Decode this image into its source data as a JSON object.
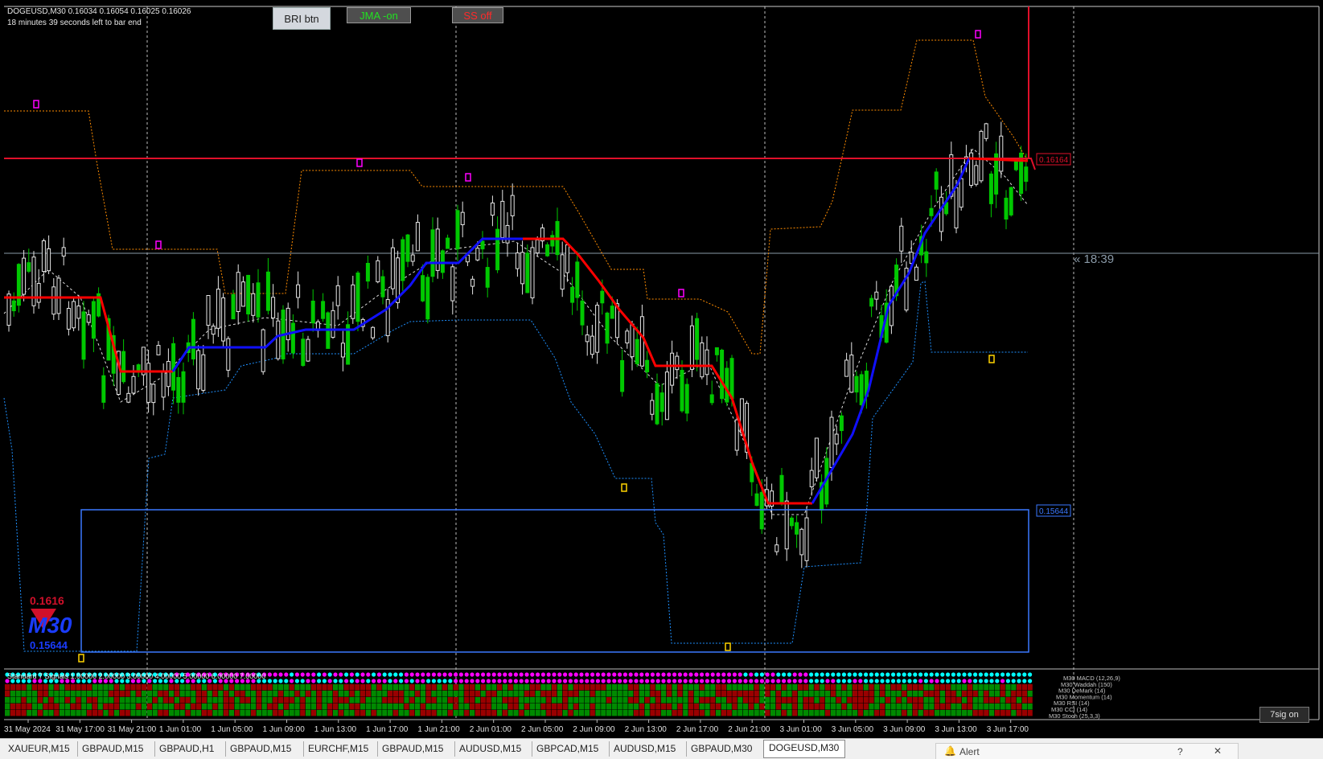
{
  "window": {
    "symbol_line": "DOGEUSD,M30  0.16034 0.16054 0.16025 0.16026",
    "countdown_line": "18 minutes 39 seconds left to bar end"
  },
  "toolbar": {
    "bri_label": "BRI btn",
    "jma_label": "JMA -on",
    "ss_label": "SS off"
  },
  "price_labels": {
    "resistance": "0.16164",
    "support": "0.15644",
    "timer": "« 18:39"
  },
  "badge": {
    "top": "0.1616",
    "timeframe": "M30",
    "bottom": "0.15644"
  },
  "x_axis": {
    "labels": [
      "31 May 2024",
      "31 May 17:00",
      "31 May 21:00",
      "1 Jun 01:00",
      "1 Jun 05:00",
      "1 Jun 09:00",
      "1 Jun 13:00",
      "1 Jun 17:00",
      "1 Jun 21:00",
      "2 Jun 01:00",
      "2 Jun 05:00",
      "2 Jun 09:00",
      "2 Jun 13:00",
      "2 Jun 17:00",
      "2 Jun 21:00",
      "3 Jun 01:00",
      "3 Jun 05:00",
      "3 Jun 09:00",
      "3 Jun 13:00",
      "3 Jun 17:00"
    ]
  },
  "indicator_panel": {
    "header": "Standard 7 Signals 1.00000 2.00000 3.00000 4.00000 5.00000 6.00000 7.00000",
    "row_labels": [
      "M30 MACD (12,26,9)",
      "M30 Waddah (150)",
      "M30 DeMark (14)",
      "M30 Momentum (14)",
      "M30 RSI (14)",
      "M30 CCI (14)",
      "M30 Stoch (25,3,3)"
    ],
    "button": "7sig on"
  },
  "tabs": [
    "XAUEUR,M15",
    "GBPAUD,M15",
    "GBPAUD,H1",
    "GBPAUD,M15",
    "EURCHF,M15",
    "GBPAUD,M15",
    "AUDUSD,M15",
    "GBPCAD,M15",
    "AUDUSD,M15",
    "GBPAUD,M30",
    "DOGEUSD,M30"
  ],
  "active_tab_index": 10,
  "alert_window": {
    "title": "Alert",
    "help": "?",
    "close": "✕"
  },
  "colors": {
    "background": "#000000",
    "bull_candle": "#00c800",
    "bear_candle": "#e6e6e6",
    "line_up": "#1010ff",
    "line_down": "#ff0000",
    "resistance": "#e0102a",
    "support_box": "#3a78ff",
    "upper_channel": "#ff8c00",
    "lower_channel": "#1e90ff",
    "signal_magenta": "#ff00ff",
    "signal_cyan": "#00ffff",
    "panel_green": "#008a00",
    "panel_red": "#9a0000"
  }
}
